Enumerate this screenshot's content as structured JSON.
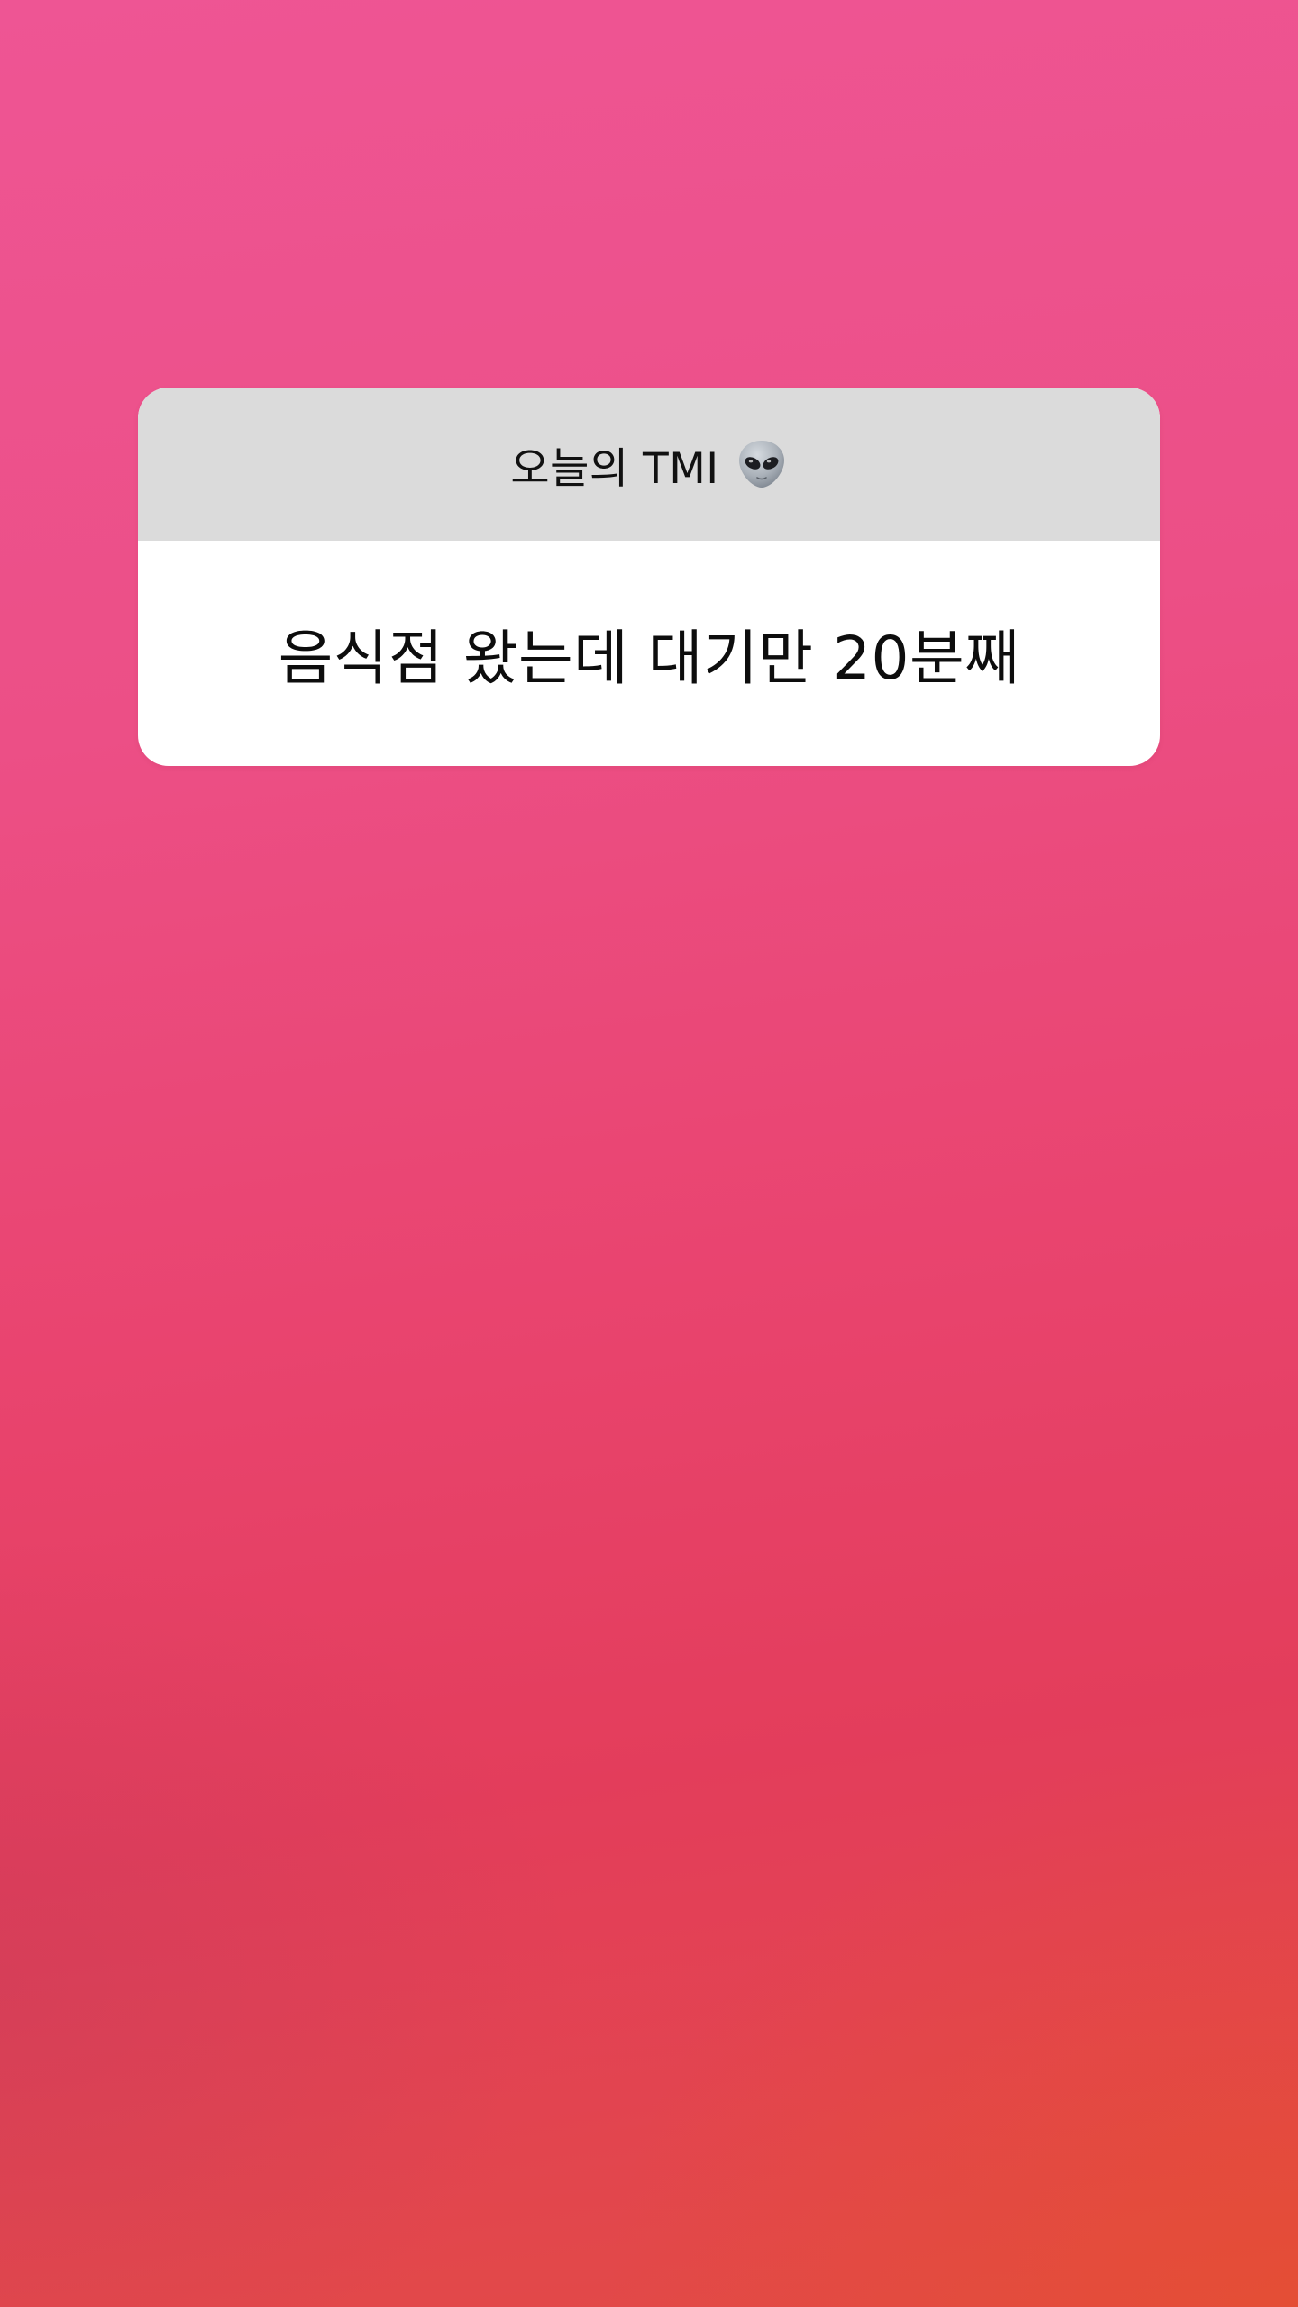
{
  "story": {
    "background_colors": [
      "#ee5594",
      "#e9446f",
      "#e24b45"
    ]
  },
  "question_sticker": {
    "prompt": "오늘의 TMI",
    "prompt_icon": "alien-emoji-icon",
    "answer": "음식점 왔는데 대기만 20분째",
    "header_color": "#dbdbdb",
    "body_color": "#ffffff"
  }
}
